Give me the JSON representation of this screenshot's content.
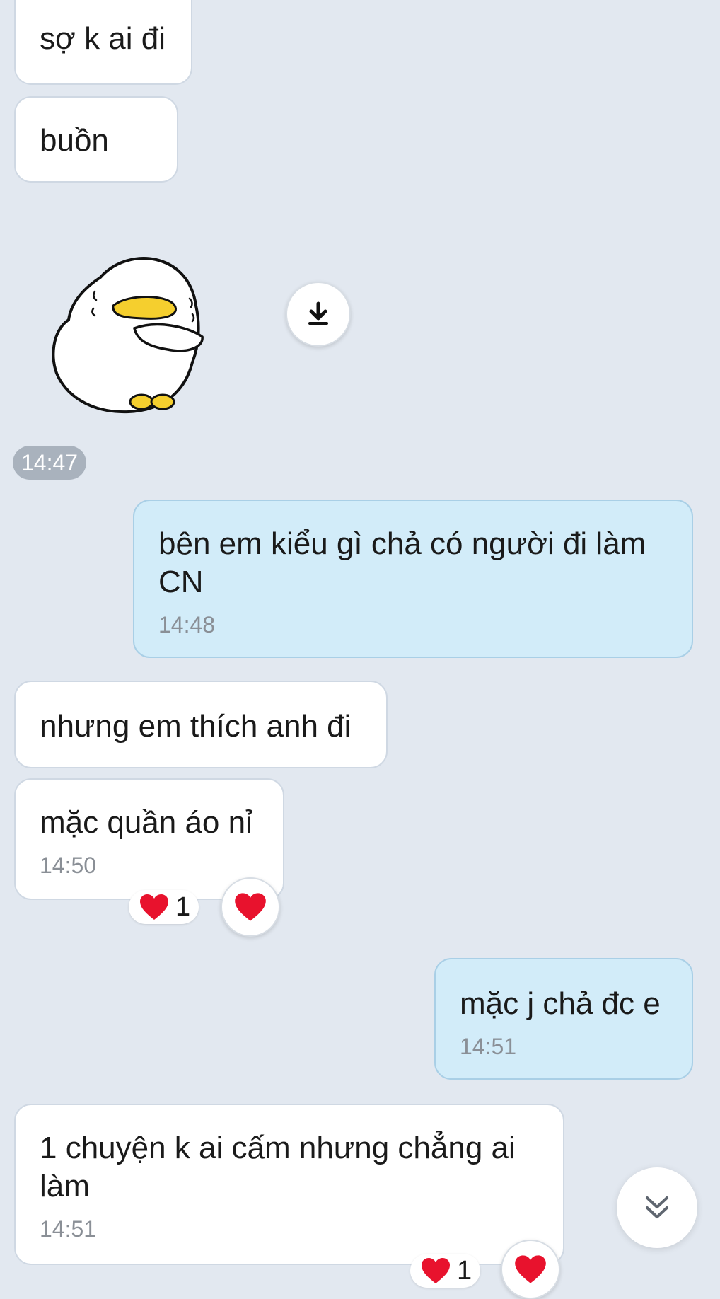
{
  "messages": {
    "m1": {
      "text": "sợ k ai đi"
    },
    "m2": {
      "text": "buồn"
    },
    "sticker": {
      "time": "14:47"
    },
    "m3": {
      "text": "bên em kiểu gì chả có người đi làm CN",
      "time": "14:48"
    },
    "m4": {
      "text": "nhưng em thích anh đi"
    },
    "m5": {
      "text": "mặc quần áo nỉ",
      "time": "14:50",
      "reaction_count": "1"
    },
    "m6": {
      "text": "mặc j chả đc e",
      "time": "14:51"
    },
    "m7": {
      "text": "1 chuyện k ai cấm nhưng chẳng ai làm",
      "time": "14:51",
      "reaction_count": "1"
    }
  },
  "icons": {
    "download": "download-icon",
    "heart": "heart-icon",
    "scroll_down": "chevron-double-down-icon",
    "sticker": "duck-sticker"
  },
  "colors": {
    "background": "#e2e8f0",
    "incoming_bubble": "#ffffff",
    "outgoing_bubble": "#d2ecf9",
    "heart": "#e8122d"
  }
}
